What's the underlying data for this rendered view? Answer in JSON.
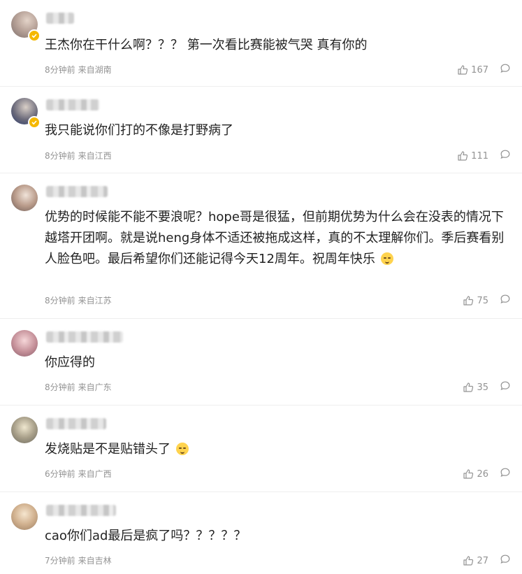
{
  "comments": [
    {
      "text": "王杰你在干什么啊？？？ 第一次看比赛能被气哭 真有你的",
      "time": "8分钟前",
      "location": "来自湖南",
      "likes": "167",
      "verified": true
    },
    {
      "text": "我只能说你们打的不像是打野病了",
      "time": "8分钟前",
      "location": "来自江西",
      "likes": "111",
      "verified": true
    },
    {
      "text": "优势的时候能不能不要浪呢？hope哥是很猛，但前期优势为什么会在没表的情况下越塔开团啊。就是说heng身体不适还被拖成这样，真的不太理解你们。季后赛看别人脸色吧。最后希望你们还能记得今天12周年。祝周年快乐",
      "time": "8分钟前",
      "location": "来自江苏",
      "likes": "75",
      "verified": false
    },
    {
      "text": "你应得的",
      "time": "8分钟前",
      "location": "来自广东",
      "likes": "35",
      "verified": false
    },
    {
      "text": "发烧贴是不是贴错头了",
      "time": "6分钟前",
      "location": "来自广西",
      "likes": "26",
      "verified": false
    },
    {
      "text": "cao你们ad最后是疯了吗？？？？？",
      "time": "7分钟前",
      "location": "来自吉林",
      "likes": "27",
      "verified": false
    }
  ],
  "icons": {
    "like": "thumbs-up-icon",
    "reply": "comment-bubble-icon",
    "verified": "verified-badge-icon",
    "emoji": "emoji-icon"
  },
  "colors": {
    "text": "#222222",
    "meta": "#939393",
    "divider": "#eeeeee",
    "verified_badge": "#f5b800"
  }
}
